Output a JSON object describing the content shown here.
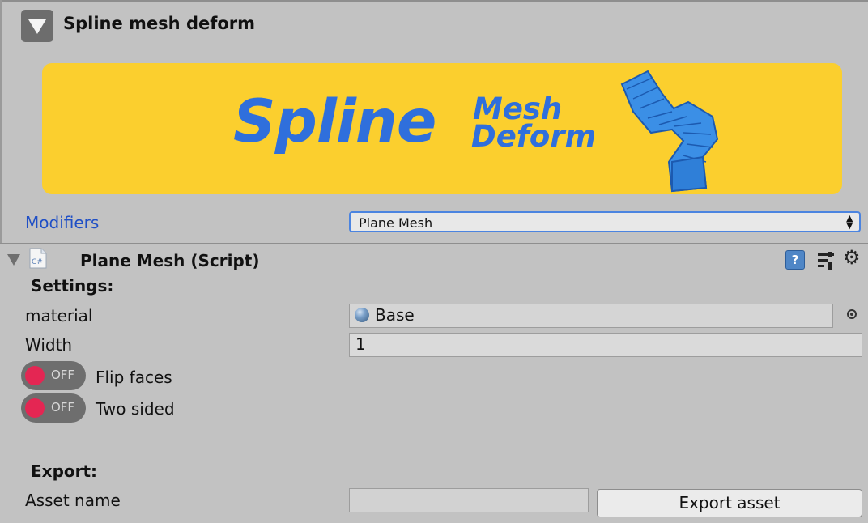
{
  "header": {
    "title": "Spline mesh deform",
    "collapse_icon": "triangle-down-icon"
  },
  "banner": {
    "word_main": "Spline",
    "word_top": "Mesh",
    "word_bottom": "Deform",
    "bg_color": "#fbcf2e",
    "text_color": "#2f6fdc"
  },
  "modifiers": {
    "label": "Modifiers",
    "selected": "Plane Mesh"
  },
  "component": {
    "title": "Plane Mesh (Script)",
    "script_icon": "cs-script-icon",
    "script_icon_text": "C#",
    "help_icon_text": "?"
  },
  "settings": {
    "heading": "Settings:",
    "material_label": "material",
    "material_value": "Base",
    "width_label": "Width",
    "width_value": "1",
    "flip_faces": {
      "label": "Flip faces",
      "state": "OFF"
    },
    "two_sided": {
      "label": "Two sided",
      "state": "OFF"
    }
  },
  "export": {
    "heading": "Export:",
    "asset_name_label": "Asset name",
    "asset_name_value": "",
    "button_label": "Export asset"
  }
}
